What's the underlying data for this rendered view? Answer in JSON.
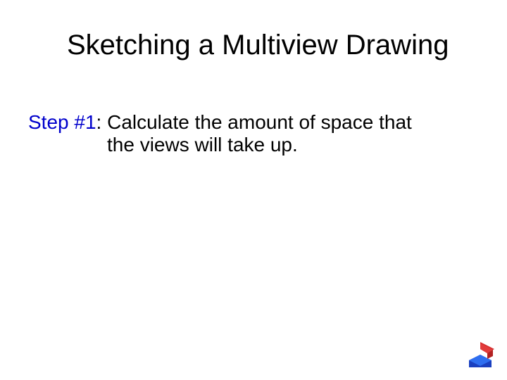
{
  "title": "Sketching a Multiview Drawing",
  "step": {
    "label": "Step #1",
    "colon": ": ",
    "text_line1": "Calculate the amount of space that",
    "text_line2": "the views will take up."
  }
}
